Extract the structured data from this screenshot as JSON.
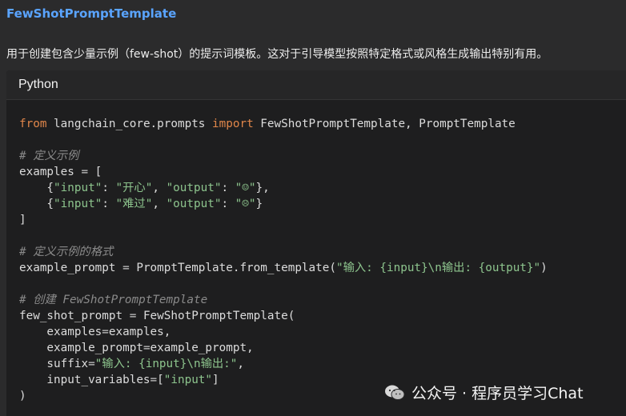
{
  "heading": "FewShotPromptTemplate",
  "description": "用于创建包含少量示例（few-shot）的提示词模板。这对于引导模型按照特定格式或风格生成输出特别有用。",
  "code_block": {
    "language": "Python",
    "lines": [
      [
        {
          "t": "from",
          "c": "kw"
        },
        {
          "t": " langchain_core.prompts ",
          "c": "tx"
        },
        {
          "t": "import",
          "c": "kw"
        },
        {
          "t": " FewShotPromptTemplate, PromptTemplate",
          "c": "tx"
        }
      ],
      [],
      [
        {
          "t": "# 定义示例",
          "c": "cm"
        }
      ],
      [
        {
          "t": "examples ",
          "c": "tx"
        },
        {
          "t": "=",
          "c": "op"
        },
        {
          "t": " [",
          "c": "tx"
        }
      ],
      [
        {
          "t": "    {",
          "c": "tx"
        },
        {
          "t": "\"input\"",
          "c": "str"
        },
        {
          "t": ": ",
          "c": "tx"
        },
        {
          "t": "\"开心\"",
          "c": "str"
        },
        {
          "t": ", ",
          "c": "tx"
        },
        {
          "t": "\"output\"",
          "c": "str"
        },
        {
          "t": ": ",
          "c": "tx"
        },
        {
          "t": "\"☺\"",
          "c": "str"
        },
        {
          "t": "},",
          "c": "tx"
        }
      ],
      [
        {
          "t": "    {",
          "c": "tx"
        },
        {
          "t": "\"input\"",
          "c": "str"
        },
        {
          "t": ": ",
          "c": "tx"
        },
        {
          "t": "\"难过\"",
          "c": "str"
        },
        {
          "t": ", ",
          "c": "tx"
        },
        {
          "t": "\"output\"",
          "c": "str"
        },
        {
          "t": ": ",
          "c": "tx"
        },
        {
          "t": "\"☹\"",
          "c": "str"
        },
        {
          "t": "}",
          "c": "tx"
        }
      ],
      [
        {
          "t": "]",
          "c": "tx"
        }
      ],
      [],
      [
        {
          "t": "# 定义示例的格式",
          "c": "cm"
        }
      ],
      [
        {
          "t": "example_prompt ",
          "c": "tx"
        },
        {
          "t": "=",
          "c": "op"
        },
        {
          "t": " PromptTemplate.from_template(",
          "c": "tx"
        },
        {
          "t": "\"输入: {input}\\n输出: {output}\"",
          "c": "str"
        },
        {
          "t": ")",
          "c": "tx"
        }
      ],
      [],
      [
        {
          "t": "# 创建 FewShotPromptTemplate",
          "c": "cm"
        }
      ],
      [
        {
          "t": "few_shot_prompt ",
          "c": "tx"
        },
        {
          "t": "=",
          "c": "op"
        },
        {
          "t": " FewShotPromptTemplate(",
          "c": "tx"
        }
      ],
      [
        {
          "t": "    examples",
          "c": "tx"
        },
        {
          "t": "=",
          "c": "op"
        },
        {
          "t": "examples,",
          "c": "tx"
        }
      ],
      [
        {
          "t": "    example_prompt",
          "c": "tx"
        },
        {
          "t": "=",
          "c": "op"
        },
        {
          "t": "example_prompt,",
          "c": "tx"
        }
      ],
      [
        {
          "t": "    suffix",
          "c": "tx"
        },
        {
          "t": "=",
          "c": "op"
        },
        {
          "t": "\"输入: {input}\\n输出:\"",
          "c": "str"
        },
        {
          "t": ",",
          "c": "tx"
        }
      ],
      [
        {
          "t": "    input_variables",
          "c": "tx"
        },
        {
          "t": "=",
          "c": "op"
        },
        {
          "t": "[",
          "c": "tx"
        },
        {
          "t": "\"input\"",
          "c": "str"
        },
        {
          "t": "]",
          "c": "tx"
        }
      ],
      [
        {
          "t": ")",
          "c": "tx"
        }
      ]
    ]
  },
  "watermark": {
    "icon": "wechat-icon",
    "text": "公众号 · 程序员学习Chat"
  },
  "colors": {
    "heading": "#5aa4ff",
    "keyword": "#e0864a",
    "string": "#8dc48d",
    "comment": "#8a8a8a",
    "background": "#2b2b2c",
    "code_background": "#1e1e1f"
  }
}
